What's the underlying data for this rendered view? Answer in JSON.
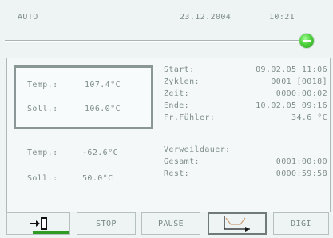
{
  "header": {
    "mode": "AUTO",
    "date": "23.12.2004",
    "time": "10:21"
  },
  "status": {
    "color": "#47c73a"
  },
  "sensors": [
    {
      "temp_label": "Temp.:",
      "temp_value": "107.4°C",
      "soll_label": "Soll.:",
      "soll_value": "106.0°C"
    },
    {
      "temp_label": "Temp.:",
      "temp_value": "-62.6°C",
      "soll_label": "Soll.:",
      "soll_value": "50.0°C"
    }
  ],
  "info": {
    "start_label": "Start:",
    "start_value": "09.02.05 11:06",
    "zyklen_label": "Zyklen:",
    "zyklen_value": "0001 [0018]",
    "zeit_label": "Zeit:",
    "zeit_value": "0000:00:02",
    "ende_label": "Ende:",
    "ende_value": "10.02.05 09:16",
    "fuehler_label": "Fr.Fühler:",
    "fuehler_value": "34.6  °C",
    "verweil_label": "Verweildauer:",
    "gesamt_label": "Gesamt:",
    "gesamt_value": "0001:00:00",
    "rest_label": "Rest:",
    "rest_value": "0000:59:58"
  },
  "buttons": {
    "exit_icon": "exit-door-icon",
    "stop": "STOP",
    "pause": "PAUSE",
    "curve_icon": "temperature-curve-icon",
    "digi": "DIGI"
  }
}
